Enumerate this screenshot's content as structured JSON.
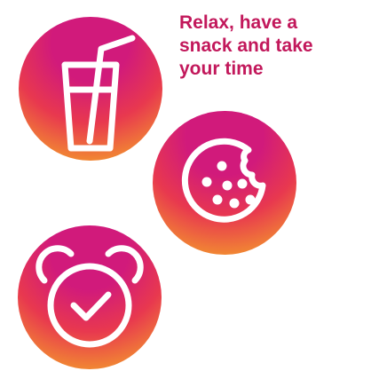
{
  "headline": {
    "lines": [
      "Relax, have a",
      "snack and take",
      "your time"
    ],
    "color": "#c2185b"
  },
  "icons": {
    "drink": "drink-glass-icon",
    "cookie": "bitten-cookie-icon",
    "clock": "alarm-clock-check-icon"
  },
  "colors": {
    "gradient_top": "#d11a7b",
    "gradient_mid": "#e8384f",
    "gradient_bottom": "#f6b024",
    "icon_stroke": "#ffffff"
  }
}
